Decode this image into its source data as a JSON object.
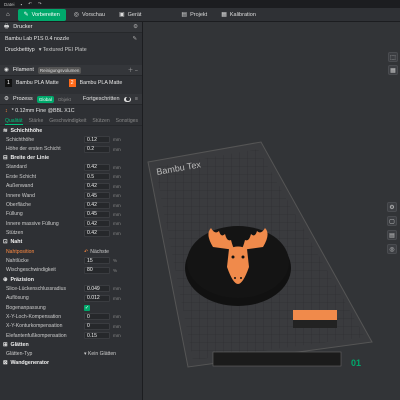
{
  "titlebar": {
    "menu": "Datei"
  },
  "nav": {
    "prepare": "Vorbereiten",
    "preview": "Vorschau",
    "device": "Gerät",
    "project": "Projekt",
    "calibration": "Kalibration"
  },
  "printer": {
    "section": "Drucker",
    "name": "Bambu Lab P1S 0.4 nozzle",
    "plate_label": "Druckbetttyp",
    "plate_value": "Textured PEI Plate"
  },
  "filament": {
    "section": "Filament",
    "badge": "Reinigungsvolumen",
    "slot1_num": "1",
    "slot1": "Bambu PLA Matte",
    "slot2_num": "2",
    "slot2": "Bambu PLA Matte"
  },
  "process": {
    "section": "Prozess",
    "global": "Global",
    "object": "Objekt",
    "advanced": "Fortgeschritten",
    "profile": "* 0.12mm Fine @BBL X1C"
  },
  "tabs": [
    "Qualität",
    "Stärke",
    "Geschwindigkeit",
    "Stützen",
    "Sonstiges"
  ],
  "groups": {
    "layer": "Schichthöhe",
    "line": "Breite der Linie",
    "seam": "Naht",
    "precision": "Präzision",
    "ironing": "Glätten",
    "wall": "Wandgenerator"
  },
  "layer_rows": [
    {
      "name": "Schichthöhe",
      "value": "0.12",
      "unit": "mm"
    },
    {
      "name": "Höhe der ersten Schicht",
      "value": "0.2",
      "unit": "mm"
    }
  ],
  "line_rows": [
    {
      "name": "Standard",
      "value": "0.42",
      "unit": "mm"
    },
    {
      "name": "Erste Schicht",
      "value": "0.5",
      "unit": "mm"
    },
    {
      "name": "Außenwand",
      "value": "0.42",
      "unit": "mm"
    },
    {
      "name": "Innere Wand",
      "value": "0.45",
      "unit": "mm"
    },
    {
      "name": "Oberfläche",
      "value": "0.42",
      "unit": "mm"
    },
    {
      "name": "Füllung",
      "value": "0.45",
      "unit": "mm"
    },
    {
      "name": "Innere massive Füllung",
      "value": "0.42",
      "unit": "mm"
    },
    {
      "name": "Stützen",
      "value": "0.42",
      "unit": "mm"
    }
  ],
  "seam": {
    "pos_label": "Nahtposition",
    "pos_value": "Nächste",
    "gap_label": "Nahtlücke",
    "gap_value": "15",
    "gap_unit": "%",
    "wipe_label": "Wischgeschwindigkeit",
    "wipe_value": "80",
    "wipe_unit": "%"
  },
  "precision_rows": [
    {
      "name": "Slice-Lückenschlussradius",
      "value": "0.049",
      "unit": "mm"
    },
    {
      "name": "Auflösung",
      "value": "0.012",
      "unit": "mm"
    },
    {
      "name": "Bogenanpassung",
      "value": "",
      "unit": ""
    },
    {
      "name": "X-Y-Loch-Kompensation",
      "value": "0",
      "unit": "mm"
    },
    {
      "name": "X-Y-Konturkompensation",
      "value": "0",
      "unit": "mm"
    },
    {
      "name": "Elefantenfußkompensation",
      "value": "0.15",
      "unit": "mm"
    }
  ],
  "ironing": {
    "type_label": "Glätten-Typ",
    "type_value": "Kein Glätten"
  },
  "plate": {
    "brand": "Bambu Tex",
    "plate_no": "01"
  }
}
